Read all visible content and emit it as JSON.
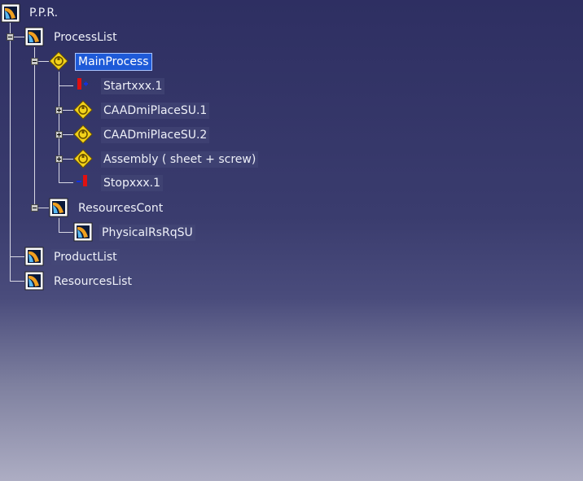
{
  "tree": {
    "root": {
      "label": "P.P.R.",
      "icon": "product-icon"
    },
    "process_list": {
      "label": "ProcessList",
      "icon": "product-icon",
      "expanded": true
    },
    "main_process": {
      "label": "MainProcess",
      "icon": "process-icon",
      "expanded": true,
      "selected": true
    },
    "start": {
      "label": "Startxxx.1",
      "icon": "start-activity-icon"
    },
    "place1": {
      "label": "CAADmiPlaceSU.1",
      "icon": "process-icon",
      "expanded": false
    },
    "place2": {
      "label": "CAADmiPlaceSU.2",
      "icon": "process-icon",
      "expanded": false
    },
    "assembly": {
      "label": "Assembly ( sheet + screw)",
      "icon": "process-icon",
      "expanded": false
    },
    "stop": {
      "label": "Stopxxx.1",
      "icon": "stop-activity-icon"
    },
    "resources_cont": {
      "label": "ResourcesCont",
      "icon": "product-icon",
      "expanded": true
    },
    "physical": {
      "label": "PhysicalRsRqSU",
      "icon": "product-icon"
    },
    "product_list": {
      "label": "ProductList",
      "icon": "product-icon"
    },
    "resources_list": {
      "label": "ResourcesList",
      "icon": "product-icon"
    }
  },
  "colors": {
    "background_top": "#2e2f62",
    "background_bottom": "#adadc3",
    "selection": "#1e5ad8",
    "tree_line": "#d8d8e4"
  }
}
